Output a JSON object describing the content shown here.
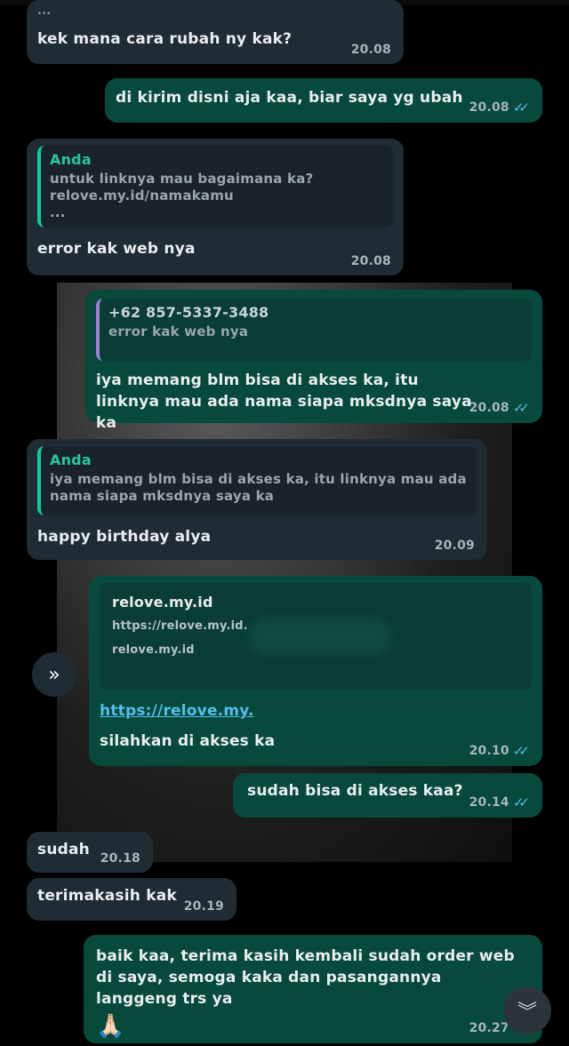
{
  "messages": [
    {
      "type": "in",
      "text": "kek mana cara rubah ny kak?",
      "time": "20.08",
      "ellipsis": "..."
    },
    {
      "type": "out",
      "text": "di kirim disni aja kaa, biar saya yg ubah",
      "time": "20.08"
    },
    {
      "type": "in",
      "quote_author": "Anda",
      "quote_text": "untuk linknya mau bagaimana ka?\nrelove.my.id/namakamu\n...",
      "text": "error kak web nya",
      "time": "20.08"
    },
    {
      "type": "out",
      "quote_author": "+62 857-5337-3488",
      "quote_text": "error kak web nya",
      "text": "iya memang blm bisa di akses ka, itu linknya mau ada nama siapa mksdnya saya ka",
      "time": "20.08"
    },
    {
      "type": "in",
      "quote_author": "Anda",
      "quote_text": "iya memang blm bisa di akses ka, itu linknya mau ada nama siapa mksdnya saya ka",
      "text": "happy birthday alya",
      "time": "20.09"
    },
    {
      "type": "out",
      "preview_title": "relove.my.id",
      "preview_url": "https://relove.my.id.",
      "preview_domain": "relove.my.id",
      "link": "https://relove.my.",
      "text": "silahkan di akses ka",
      "time": "20.10"
    },
    {
      "type": "out",
      "text": "sudah bisa di akses kaa?",
      "time": "20.14"
    },
    {
      "type": "in",
      "text": "sudah",
      "time": "20.18"
    },
    {
      "type": "in",
      "text": "terimakasih kak",
      "time": "20.19"
    },
    {
      "type": "out",
      "text": "baik kaa, terima kasih kembali sudah order web di saya, semoga kaka dan pasangannya langgeng trs ya",
      "emoji": "🙏🏻",
      "time": "20.27"
    }
  ],
  "icons": {
    "read_receipt": "double-check-icon",
    "forward": "forward-icon",
    "scroll": "scroll-down-icon"
  },
  "colors": {
    "incoming": "#202c33",
    "outgoing": "#074a3c",
    "link": "#53bdeb",
    "check": "#53bdeb"
  }
}
